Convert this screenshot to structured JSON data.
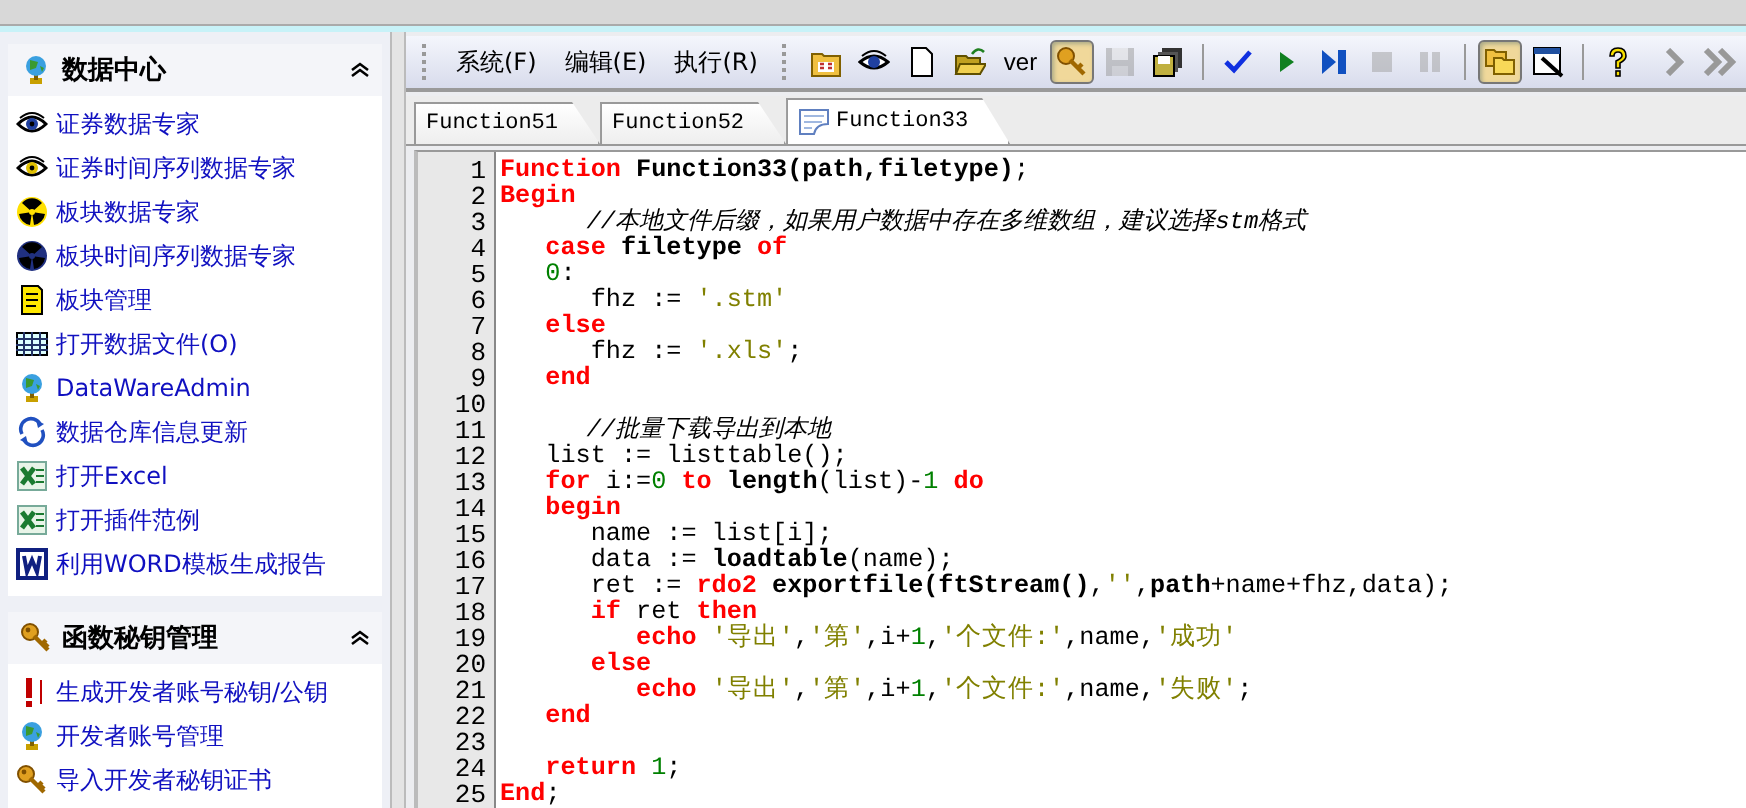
{
  "sidebar": {
    "groups": [
      {
        "title": "数据中心",
        "expanded": true,
        "items": [
          {
            "label": "证券数据专家"
          },
          {
            "label": "证券时间序列数据专家"
          },
          {
            "label": "板块数据专家"
          },
          {
            "label": "板块时间序列数据专家"
          },
          {
            "label": "板块管理"
          },
          {
            "label": "打开数据文件(O)"
          },
          {
            "label": "DataWareAdmin"
          },
          {
            "label": "数据仓库信息更新"
          },
          {
            "label": "打开Excel"
          },
          {
            "label": "打开插件范例"
          },
          {
            "label": "利用WORD模板生成报告"
          }
        ]
      },
      {
        "title": "函数秘钥管理",
        "expanded": true,
        "items": [
          {
            "label": "生成开发者账号秘钥/公钥"
          },
          {
            "label": "开发者账号管理"
          },
          {
            "label": "导入开发者秘钥证书"
          }
        ]
      }
    ]
  },
  "menu": [
    {
      "label": "系统(F)"
    },
    {
      "label": "编辑(E)"
    },
    {
      "label": "执行(R)"
    }
  ],
  "toolbar": [
    {
      "kind": "button",
      "pressed": false,
      "disabled": false
    },
    {
      "kind": "button",
      "pressed": false,
      "disabled": false
    },
    {
      "kind": "button",
      "pressed": false,
      "disabled": false
    },
    {
      "kind": "button",
      "pressed": false,
      "disabled": false
    },
    {
      "kind": "text",
      "label": "ver",
      "pressed": false,
      "disabled": false
    },
    {
      "kind": "button",
      "pressed": true,
      "disabled": false
    },
    {
      "kind": "button",
      "pressed": false,
      "disabled": true
    },
    {
      "kind": "button",
      "pressed": false,
      "disabled": false
    },
    {
      "kind": "separator"
    },
    {
      "kind": "button",
      "pressed": false,
      "disabled": false
    },
    {
      "kind": "button",
      "pressed": false,
      "disabled": false
    },
    {
      "kind": "button",
      "pressed": false,
      "disabled": false
    },
    {
      "kind": "button",
      "pressed": false,
      "disabled": true
    },
    {
      "kind": "button",
      "pressed": false,
      "disabled": true
    },
    {
      "kind": "separator"
    },
    {
      "kind": "button",
      "pressed": true,
      "disabled": false
    },
    {
      "kind": "button",
      "pressed": false,
      "disabled": false
    },
    {
      "kind": "separator"
    },
    {
      "kind": "button",
      "pressed": false,
      "disabled": false
    }
  ],
  "tabs": [
    {
      "label": "Function51",
      "selected": false
    },
    {
      "label": "Function52",
      "selected": false
    },
    {
      "label": "Function33",
      "selected": true
    }
  ],
  "editor": {
    "lines": [
      {
        "number": "1",
        "tokens": [
          {
            "kind": "keyword",
            "text": "Function "
          },
          {
            "kind": "bold",
            "text": "Function33(path,filetype)"
          },
          {
            "kind": "plain",
            "text": ";"
          }
        ]
      },
      {
        "number": "2",
        "tokens": [
          {
            "kind": "keyword",
            "text": "Begin"
          }
        ]
      },
      {
        "number": "3",
        "tokens": [
          {
            "kind": "comment",
            "text": "      //本地文件后缀，如果用户数据中存在多维数组，建议选择stm格式"
          }
        ]
      },
      {
        "number": "4",
        "tokens": [
          {
            "kind": "keyword",
            "text": "   case "
          },
          {
            "kind": "bold",
            "text": "filetype "
          },
          {
            "kind": "keyword",
            "text": "of"
          }
        ]
      },
      {
        "number": "5",
        "tokens": [
          {
            "kind": "number",
            "text": "   0"
          },
          {
            "kind": "plain",
            "text": ":"
          }
        ]
      },
      {
        "number": "6",
        "tokens": [
          {
            "kind": "plain",
            "text": "      fhz := "
          },
          {
            "kind": "string",
            "text": "'.stm'"
          }
        ]
      },
      {
        "number": "7",
        "tokens": [
          {
            "kind": "keyword",
            "text": "   else"
          }
        ]
      },
      {
        "number": "8",
        "tokens": [
          {
            "kind": "plain",
            "text": "      fhz := "
          },
          {
            "kind": "string",
            "text": "'.xls'"
          },
          {
            "kind": "plain",
            "text": ";"
          }
        ]
      },
      {
        "number": "9",
        "tokens": [
          {
            "kind": "keyword",
            "text": "   end"
          }
        ]
      },
      {
        "number": "10"
      },
      {
        "number": "11",
        "tokens": [
          {
            "kind": "comment",
            "text": "      //批量下载导出到本地"
          }
        ]
      },
      {
        "number": "12",
        "tokens": [
          {
            "kind": "plain",
            "text": "   list := listtable();"
          }
        ]
      },
      {
        "number": "13",
        "tokens": [
          {
            "kind": "keyword",
            "text": "   for"
          },
          {
            "kind": "plain",
            "text": " i:="
          },
          {
            "kind": "number",
            "text": "0 "
          },
          {
            "kind": "keyword",
            "text": "to "
          },
          {
            "kind": "bold",
            "text": "length"
          },
          {
            "kind": "plain",
            "text": "(list)-"
          },
          {
            "kind": "number",
            "text": "1 "
          },
          {
            "kind": "keyword",
            "text": "do"
          }
        ]
      },
      {
        "number": "14",
        "tokens": [
          {
            "kind": "keyword",
            "text": "   begin"
          }
        ]
      },
      {
        "number": "15",
        "tokens": [
          {
            "kind": "plain",
            "text": "      name := list[i];"
          }
        ]
      },
      {
        "number": "16",
        "tokens": [
          {
            "kind": "plain",
            "text": "      data := "
          },
          {
            "kind": "bold",
            "text": "loadtable"
          },
          {
            "kind": "plain",
            "text": "(name);"
          }
        ]
      },
      {
        "number": "17",
        "tokens": [
          {
            "kind": "plain",
            "text": "      ret := "
          },
          {
            "kind": "keyword",
            "text": "rdo2 "
          },
          {
            "kind": "bold",
            "text": "exportfile(ftStream()"
          },
          {
            "kind": "plain",
            "text": ","
          },
          {
            "kind": "string",
            "text": "''"
          },
          {
            "kind": "plain",
            "text": ","
          },
          {
            "kind": "bold",
            "text": "path"
          },
          {
            "kind": "plain",
            "text": "+name+fhz,data);"
          }
        ]
      },
      {
        "number": "18",
        "tokens": [
          {
            "kind": "keyword",
            "text": "      if"
          },
          {
            "kind": "plain",
            "text": " ret "
          },
          {
            "kind": "keyword",
            "text": "then"
          }
        ]
      },
      {
        "number": "19",
        "tokens": [
          {
            "kind": "keyword",
            "text": "         echo "
          },
          {
            "kind": "string",
            "text": "'导出'"
          },
          {
            "kind": "plain",
            "text": ","
          },
          {
            "kind": "string",
            "text": "'第'"
          },
          {
            "kind": "plain",
            "text": ",i+"
          },
          {
            "kind": "number",
            "text": "1"
          },
          {
            "kind": "plain",
            "text": ","
          },
          {
            "kind": "string",
            "text": "'个文件:'"
          },
          {
            "kind": "plain",
            "text": ",name,"
          },
          {
            "kind": "string",
            "text": "'成功'"
          }
        ]
      },
      {
        "number": "20",
        "tokens": [
          {
            "kind": "keyword",
            "text": "      else"
          }
        ]
      },
      {
        "number": "21",
        "tokens": [
          {
            "kind": "keyword",
            "text": "         echo "
          },
          {
            "kind": "string",
            "text": "'导出'"
          },
          {
            "kind": "plain",
            "text": ","
          },
          {
            "kind": "string",
            "text": "'第'"
          },
          {
            "kind": "plain",
            "text": ",i+"
          },
          {
            "kind": "number",
            "text": "1"
          },
          {
            "kind": "plain",
            "text": ","
          },
          {
            "kind": "string",
            "text": "'个文件:'"
          },
          {
            "kind": "plain",
            "text": ",name,"
          },
          {
            "kind": "string",
            "text": "'失败'"
          },
          {
            "kind": "plain",
            "text": ";"
          }
        ]
      },
      {
        "number": "22",
        "tokens": [
          {
            "kind": "keyword",
            "text": "   end"
          }
        ]
      },
      {
        "number": "23"
      },
      {
        "number": "24",
        "tokens": [
          {
            "kind": "keyword",
            "text": "   return "
          },
          {
            "kind": "number",
            "text": "1"
          },
          {
            "kind": "plain",
            "text": ";"
          }
        ]
      },
      {
        "number": "25",
        "tokens": [
          {
            "kind": "keyword",
            "text": "End"
          },
          {
            "kind": "plain",
            "text": ";"
          }
        ]
      }
    ]
  }
}
